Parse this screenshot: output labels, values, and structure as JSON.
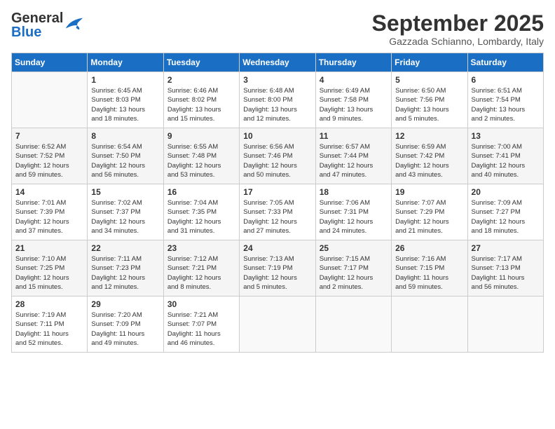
{
  "header": {
    "logo_general": "General",
    "logo_blue": "Blue",
    "month_title": "September 2025",
    "location": "Gazzada Schianno, Lombardy, Italy"
  },
  "columns": [
    "Sunday",
    "Monday",
    "Tuesday",
    "Wednesday",
    "Thursday",
    "Friday",
    "Saturday"
  ],
  "weeks": [
    [
      {
        "num": "",
        "info": ""
      },
      {
        "num": "1",
        "info": "Sunrise: 6:45 AM\nSunset: 8:03 PM\nDaylight: 13 hours\nand 18 minutes."
      },
      {
        "num": "2",
        "info": "Sunrise: 6:46 AM\nSunset: 8:02 PM\nDaylight: 13 hours\nand 15 minutes."
      },
      {
        "num": "3",
        "info": "Sunrise: 6:48 AM\nSunset: 8:00 PM\nDaylight: 13 hours\nand 12 minutes."
      },
      {
        "num": "4",
        "info": "Sunrise: 6:49 AM\nSunset: 7:58 PM\nDaylight: 13 hours\nand 9 minutes."
      },
      {
        "num": "5",
        "info": "Sunrise: 6:50 AM\nSunset: 7:56 PM\nDaylight: 13 hours\nand 5 minutes."
      },
      {
        "num": "6",
        "info": "Sunrise: 6:51 AM\nSunset: 7:54 PM\nDaylight: 13 hours\nand 2 minutes."
      }
    ],
    [
      {
        "num": "7",
        "info": "Sunrise: 6:52 AM\nSunset: 7:52 PM\nDaylight: 12 hours\nand 59 minutes."
      },
      {
        "num": "8",
        "info": "Sunrise: 6:54 AM\nSunset: 7:50 PM\nDaylight: 12 hours\nand 56 minutes."
      },
      {
        "num": "9",
        "info": "Sunrise: 6:55 AM\nSunset: 7:48 PM\nDaylight: 12 hours\nand 53 minutes."
      },
      {
        "num": "10",
        "info": "Sunrise: 6:56 AM\nSunset: 7:46 PM\nDaylight: 12 hours\nand 50 minutes."
      },
      {
        "num": "11",
        "info": "Sunrise: 6:57 AM\nSunset: 7:44 PM\nDaylight: 12 hours\nand 47 minutes."
      },
      {
        "num": "12",
        "info": "Sunrise: 6:59 AM\nSunset: 7:42 PM\nDaylight: 12 hours\nand 43 minutes."
      },
      {
        "num": "13",
        "info": "Sunrise: 7:00 AM\nSunset: 7:41 PM\nDaylight: 12 hours\nand 40 minutes."
      }
    ],
    [
      {
        "num": "14",
        "info": "Sunrise: 7:01 AM\nSunset: 7:39 PM\nDaylight: 12 hours\nand 37 minutes."
      },
      {
        "num": "15",
        "info": "Sunrise: 7:02 AM\nSunset: 7:37 PM\nDaylight: 12 hours\nand 34 minutes."
      },
      {
        "num": "16",
        "info": "Sunrise: 7:04 AM\nSunset: 7:35 PM\nDaylight: 12 hours\nand 31 minutes."
      },
      {
        "num": "17",
        "info": "Sunrise: 7:05 AM\nSunset: 7:33 PM\nDaylight: 12 hours\nand 27 minutes."
      },
      {
        "num": "18",
        "info": "Sunrise: 7:06 AM\nSunset: 7:31 PM\nDaylight: 12 hours\nand 24 minutes."
      },
      {
        "num": "19",
        "info": "Sunrise: 7:07 AM\nSunset: 7:29 PM\nDaylight: 12 hours\nand 21 minutes."
      },
      {
        "num": "20",
        "info": "Sunrise: 7:09 AM\nSunset: 7:27 PM\nDaylight: 12 hours\nand 18 minutes."
      }
    ],
    [
      {
        "num": "21",
        "info": "Sunrise: 7:10 AM\nSunset: 7:25 PM\nDaylight: 12 hours\nand 15 minutes."
      },
      {
        "num": "22",
        "info": "Sunrise: 7:11 AM\nSunset: 7:23 PM\nDaylight: 12 hours\nand 12 minutes."
      },
      {
        "num": "23",
        "info": "Sunrise: 7:12 AM\nSunset: 7:21 PM\nDaylight: 12 hours\nand 8 minutes."
      },
      {
        "num": "24",
        "info": "Sunrise: 7:13 AM\nSunset: 7:19 PM\nDaylight: 12 hours\nand 5 minutes."
      },
      {
        "num": "25",
        "info": "Sunrise: 7:15 AM\nSunset: 7:17 PM\nDaylight: 12 hours\nand 2 minutes."
      },
      {
        "num": "26",
        "info": "Sunrise: 7:16 AM\nSunset: 7:15 PM\nDaylight: 11 hours\nand 59 minutes."
      },
      {
        "num": "27",
        "info": "Sunrise: 7:17 AM\nSunset: 7:13 PM\nDaylight: 11 hours\nand 56 minutes."
      }
    ],
    [
      {
        "num": "28",
        "info": "Sunrise: 7:19 AM\nSunset: 7:11 PM\nDaylight: 11 hours\nand 52 minutes."
      },
      {
        "num": "29",
        "info": "Sunrise: 7:20 AM\nSunset: 7:09 PM\nDaylight: 11 hours\nand 49 minutes."
      },
      {
        "num": "30",
        "info": "Sunrise: 7:21 AM\nSunset: 7:07 PM\nDaylight: 11 hours\nand 46 minutes."
      },
      {
        "num": "",
        "info": ""
      },
      {
        "num": "",
        "info": ""
      },
      {
        "num": "",
        "info": ""
      },
      {
        "num": "",
        "info": ""
      }
    ]
  ]
}
